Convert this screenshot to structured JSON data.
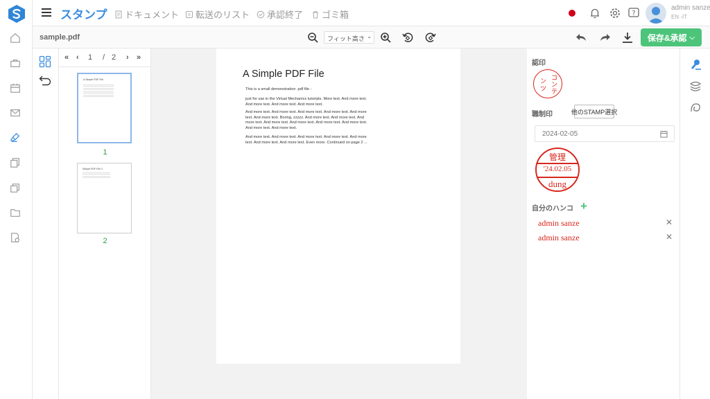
{
  "app": {
    "title": "スタンプ"
  },
  "nav": [
    {
      "label": "ドキュメント",
      "icon": "document-icon"
    },
    {
      "label": "転送のリスト",
      "icon": "transfer-list-icon"
    },
    {
      "label": "承認終了",
      "icon": "check-circle-icon"
    },
    {
      "label": "ゴミ箱",
      "icon": "trash-icon"
    }
  ],
  "user": {
    "name": "admin sanze",
    "lang": "EN -IT"
  },
  "toolbar": {
    "filename": "sample.pdf",
    "zoom_option": "フィット高さ",
    "save_label": "保存&承認"
  },
  "pager": {
    "current": "1",
    "separator": "/",
    "total": "2"
  },
  "thumbnails": [
    {
      "num": "1"
    },
    {
      "num": "2"
    }
  ],
  "thumb_text": {
    "page1_title": "A Simple PDF File",
    "page2_title": "Simple PDF File 2"
  },
  "pdf": {
    "title": "A Simple PDF File",
    "paragraphs": [
      "This is a small demonstration .pdf file -",
      "just for use in the Virtual Mechanics tutorials. More text. And more text. And more text. And more text. And more text.",
      "And more text. And more text. And more text. And more text. And more text. And more text. Boring, zzzzz. And more text. And more text. And more text. And more text. And more text. And more text. And more text. And more text. And more text.",
      "And more text. And more text. And more text. And more text. And more text. And more text. And more text. Even more. Continued on page 2 ..."
    ]
  },
  "panel": {
    "seal_label": "認印",
    "seal_chars": [
      "コ",
      "ン",
      "テ",
      "ン",
      "ツ"
    ],
    "job_seal_label": "職制印",
    "other_stamp_button": "他のSTAMP選択",
    "date_value": "2024-02-05",
    "date_stamp": {
      "top": "管理",
      "middle": "'24.02.05",
      "bottom": "dung"
    },
    "my_hanko_label": "自分のハンコ",
    "hanko_items": [
      "admin sanze",
      "admin sanze"
    ]
  },
  "colors": {
    "brand": "#3a8de0",
    "save": "#4cc47a",
    "stamp": "#d8261c"
  }
}
